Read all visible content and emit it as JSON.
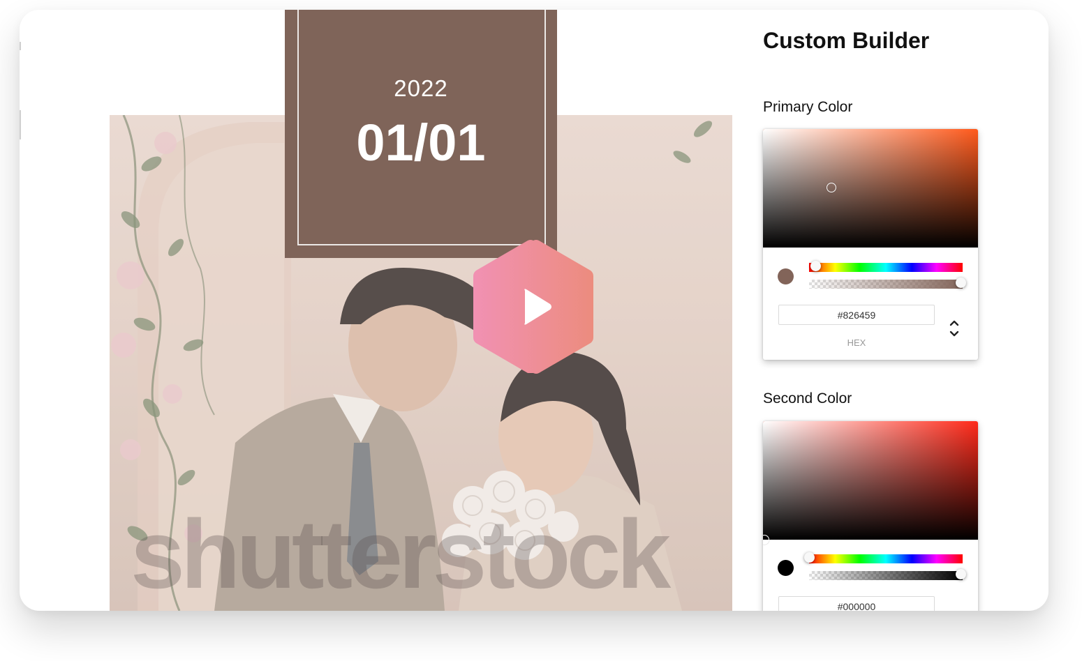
{
  "date_card": {
    "year": "2022",
    "day": "01/01",
    "color": "#7f6459"
  },
  "photo": {
    "watermark": "shutterstock"
  },
  "play_button": {
    "icon": "play-icon",
    "gradient": [
      "#f191b3",
      "#ec8c7e"
    ]
  },
  "builder": {
    "title": "Custom Builder",
    "primary": {
      "label": "Primary Color",
      "hex": "#826459",
      "hex_label": "HEX",
      "hue_color": "#ff5a1c",
      "hue_level": 0.03,
      "alpha_level": 1.0
    },
    "second": {
      "label": "Second Color",
      "hex": "#000000",
      "hue_color": "#ff2a1a",
      "hue_level": 0.0,
      "alpha_level": 1.0
    }
  }
}
